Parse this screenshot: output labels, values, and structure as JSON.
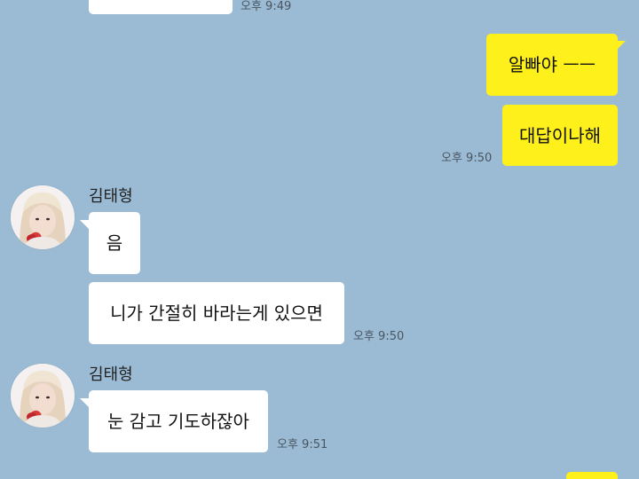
{
  "messages": {
    "prev_time": "오후 9:49",
    "out_1": "알빠야 ㅡㅡ",
    "out_2": "대답이나해",
    "out_time": "오후 9:50",
    "sender_name_1": "김태형",
    "in_1": "음",
    "in_2": "니가 간절히 바라는게 있으면",
    "in_time_1": "오후 9:50",
    "sender_name_2": "김태형",
    "in_3": "눈 감고 기도하잖아",
    "in_time_2": "오후 9:51"
  },
  "colors": {
    "background": "#9bbbd4",
    "outgoing_bubble": "#fef01b",
    "incoming_bubble": "#ffffff"
  },
  "icons": {
    "avatar": "profile-photo-avatar"
  }
}
